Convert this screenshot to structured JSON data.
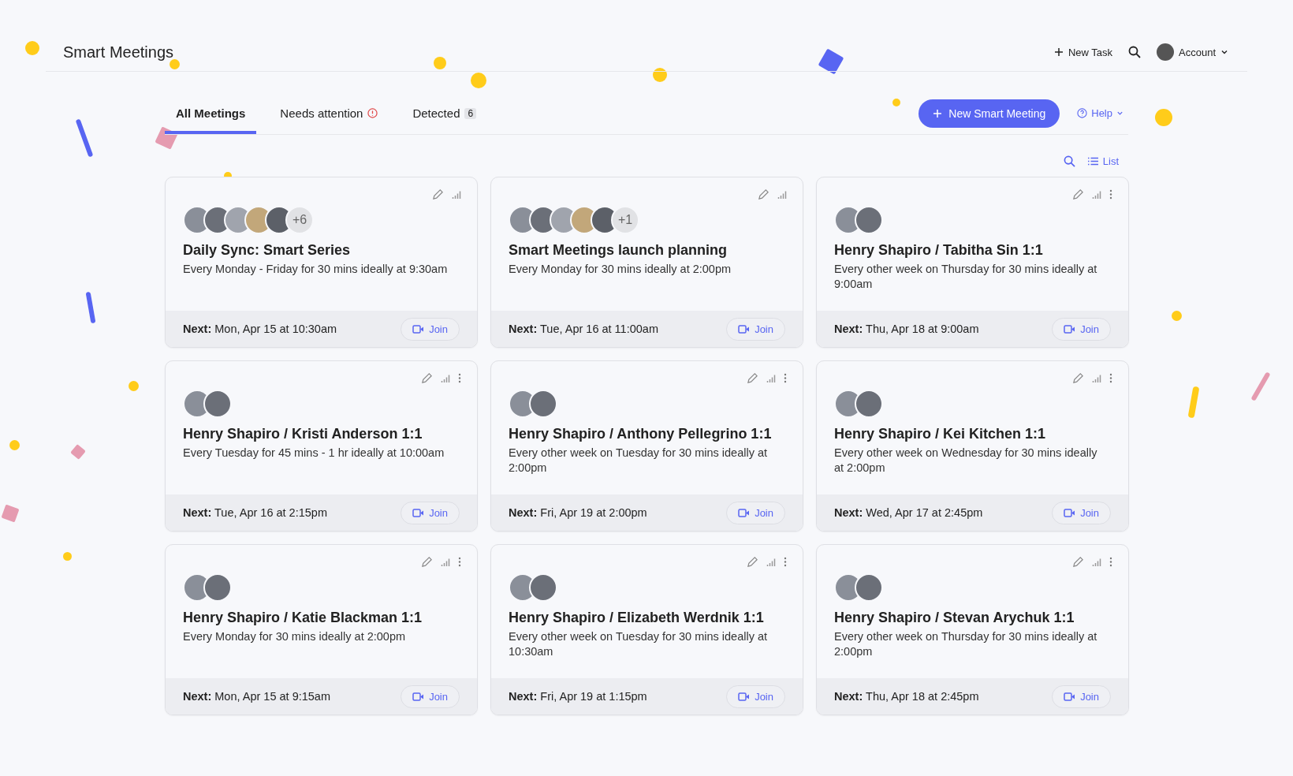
{
  "header": {
    "title": "Smart Meetings",
    "new_task": "New Task",
    "account": "Account"
  },
  "tabs": [
    {
      "label": "All Meetings",
      "selected": true,
      "kind": "plain"
    },
    {
      "label": "Needs attention",
      "selected": false,
      "kind": "alert"
    },
    {
      "label": "Detected",
      "selected": false,
      "kind": "count",
      "count": "6"
    }
  ],
  "new_meeting_button": "New Smart Meeting",
  "help": "Help",
  "view_toggle": "List",
  "cards": [
    {
      "title": "Daily Sync: Smart Series",
      "schedule": "Every Monday - Friday for 30 mins ideally at 9:30am",
      "next_label": "Next:",
      "next": "Mon, Apr 15 at 10:30am",
      "join": "Join",
      "menu": false,
      "avatars": [
        {
          "kind": "photo"
        },
        {
          "kind": "photo"
        },
        {
          "kind": "photo"
        },
        {
          "kind": "photo"
        },
        {
          "kind": "photo"
        }
      ],
      "extra": "+6"
    },
    {
      "title": "Smart Meetings launch planning",
      "schedule": "Every Monday for 30 mins ideally at 2:00pm",
      "next_label": "Next:",
      "next": "Tue, Apr 16 at 11:00am",
      "join": "Join",
      "menu": false,
      "avatars": [
        {
          "kind": "photo"
        },
        {
          "kind": "photo"
        },
        {
          "kind": "photo"
        },
        {
          "kind": "photo"
        },
        {
          "kind": "photo"
        }
      ],
      "extra": "+1"
    },
    {
      "title": "Henry Shapiro / Tabitha Sin 1:1",
      "schedule": "Every other week on Thursday for 30 mins ideally at 9:00am",
      "next_label": "Next:",
      "next": "Thu, Apr 18 at 9:00am",
      "join": "Join",
      "menu": true,
      "avatars": [
        {
          "kind": "photo"
        },
        {
          "kind": "photo"
        }
      ]
    },
    {
      "title": "Henry Shapiro / Kristi Anderson 1:1",
      "schedule": "Every Tuesday for 45 mins - 1 hr ideally at 10:00am",
      "next_label": "Next:",
      "next": "Tue, Apr 16 at 2:15pm",
      "join": "Join",
      "menu": true,
      "avatars": [
        {
          "kind": "photo"
        },
        {
          "kind": "photo"
        }
      ]
    },
    {
      "title": "Henry Shapiro / Anthony Pellegrino 1:1",
      "schedule": "Every other week on Tuesday for 30 mins ideally at 2:00pm",
      "next_label": "Next:",
      "next": "Fri, Apr 19 at 2:00pm",
      "join": "Join",
      "menu": true,
      "avatars": [
        {
          "kind": "photo"
        },
        {
          "kind": "photo"
        }
      ]
    },
    {
      "title": "Henry Shapiro / Kei Kitchen 1:1",
      "schedule": "Every other week on Wednesday for 30 mins ideally at 2:00pm",
      "next_label": "Next:",
      "next": "Wed, Apr 17 at 2:45pm",
      "join": "Join",
      "menu": true,
      "avatars": [
        {
          "kind": "photo"
        },
        {
          "kind": "photo"
        }
      ]
    },
    {
      "title": "Henry Shapiro / Katie Blackman 1:1",
      "schedule": "Every Monday for 30 mins ideally at 2:00pm",
      "next_label": "Next:",
      "next": "Mon, Apr 15 at 9:15am",
      "join": "Join",
      "menu": true,
      "avatars": [
        {
          "kind": "photo"
        },
        {
          "kind": "photo"
        }
      ]
    },
    {
      "title": "Henry Shapiro / Elizabeth Werdnik 1:1",
      "schedule": "Every other week on Tuesday for 30 mins ideally at 10:30am",
      "next_label": "Next:",
      "next": "Fri, Apr 19 at 1:15pm",
      "join": "Join",
      "menu": true,
      "avatars": [
        {
          "kind": "photo"
        },
        {
          "kind": "photo"
        }
      ]
    },
    {
      "title": "Henry Shapiro / Stevan Arychuk 1:1",
      "schedule": "Every other week on Thursday for 30 mins ideally at 2:00pm",
      "next_label": "Next:",
      "next": "Thu, Apr 18 at 2:45pm",
      "join": "Join",
      "menu": true,
      "avatars": [
        {
          "kind": "photo"
        },
        {
          "kind": "photo"
        }
      ]
    }
  ]
}
